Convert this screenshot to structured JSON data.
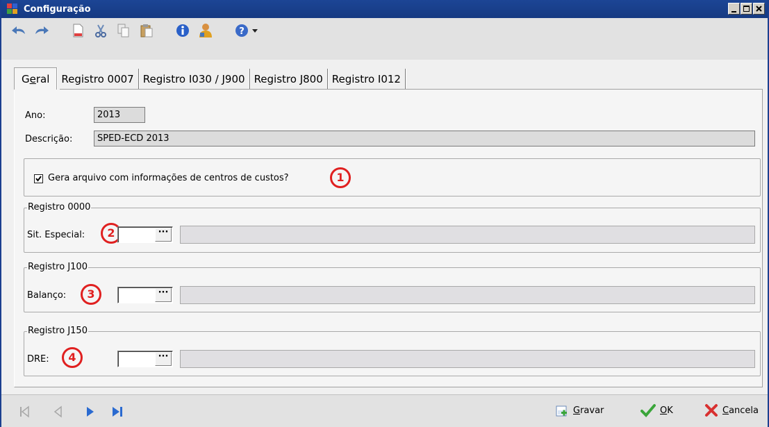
{
  "window": {
    "title": "Configuração"
  },
  "toolbar": {
    "icons": [
      "undo-icon",
      "redo-icon",
      "new-document-icon",
      "cut-icon",
      "copy-icon",
      "paste-icon",
      "info-icon",
      "user-icon",
      "help-icon",
      "dropdown-arrow-icon"
    ]
  },
  "tabs": [
    {
      "label": "Geral",
      "active": true
    },
    {
      "label": "Registro 0007"
    },
    {
      "label": "Registro I030 / J900"
    },
    {
      "label": "Registro J800"
    },
    {
      "label": "Registro I012"
    }
  ],
  "form": {
    "ano_label": "Ano:",
    "ano_value": "2013",
    "descricao_label": "Descrição:",
    "descricao_value": "SPED-ECD 2013",
    "checkbox_label": "Gera arquivo com informações de centros de custos?",
    "checkbox_checked": true
  },
  "groups": {
    "g0000": {
      "title": "Registro 0000",
      "field_label": "Sit. Especial:",
      "badge": "2"
    },
    "gJ100": {
      "title": "Registro J100",
      "field_label": "Balanço:",
      "badge": "3"
    },
    "gJ150": {
      "title": "Registro J150",
      "field_label": "DRE:",
      "badge": "4"
    }
  },
  "badge1": "1",
  "lookup_button": "···",
  "actions": {
    "gravar_first": "G",
    "gravar_rest": "ravar",
    "ok_first": "O",
    "ok_rest": "K",
    "cancela_first": "C",
    "cancela_rest": "ancela"
  },
  "tab_underline": {
    "first": "G",
    "accel": "e",
    "rest": "ral"
  },
  "colors": {
    "titlebar": "#1c4595",
    "badge": "#e02020",
    "ok": "#3aa53a",
    "cancel": "#d83030"
  }
}
